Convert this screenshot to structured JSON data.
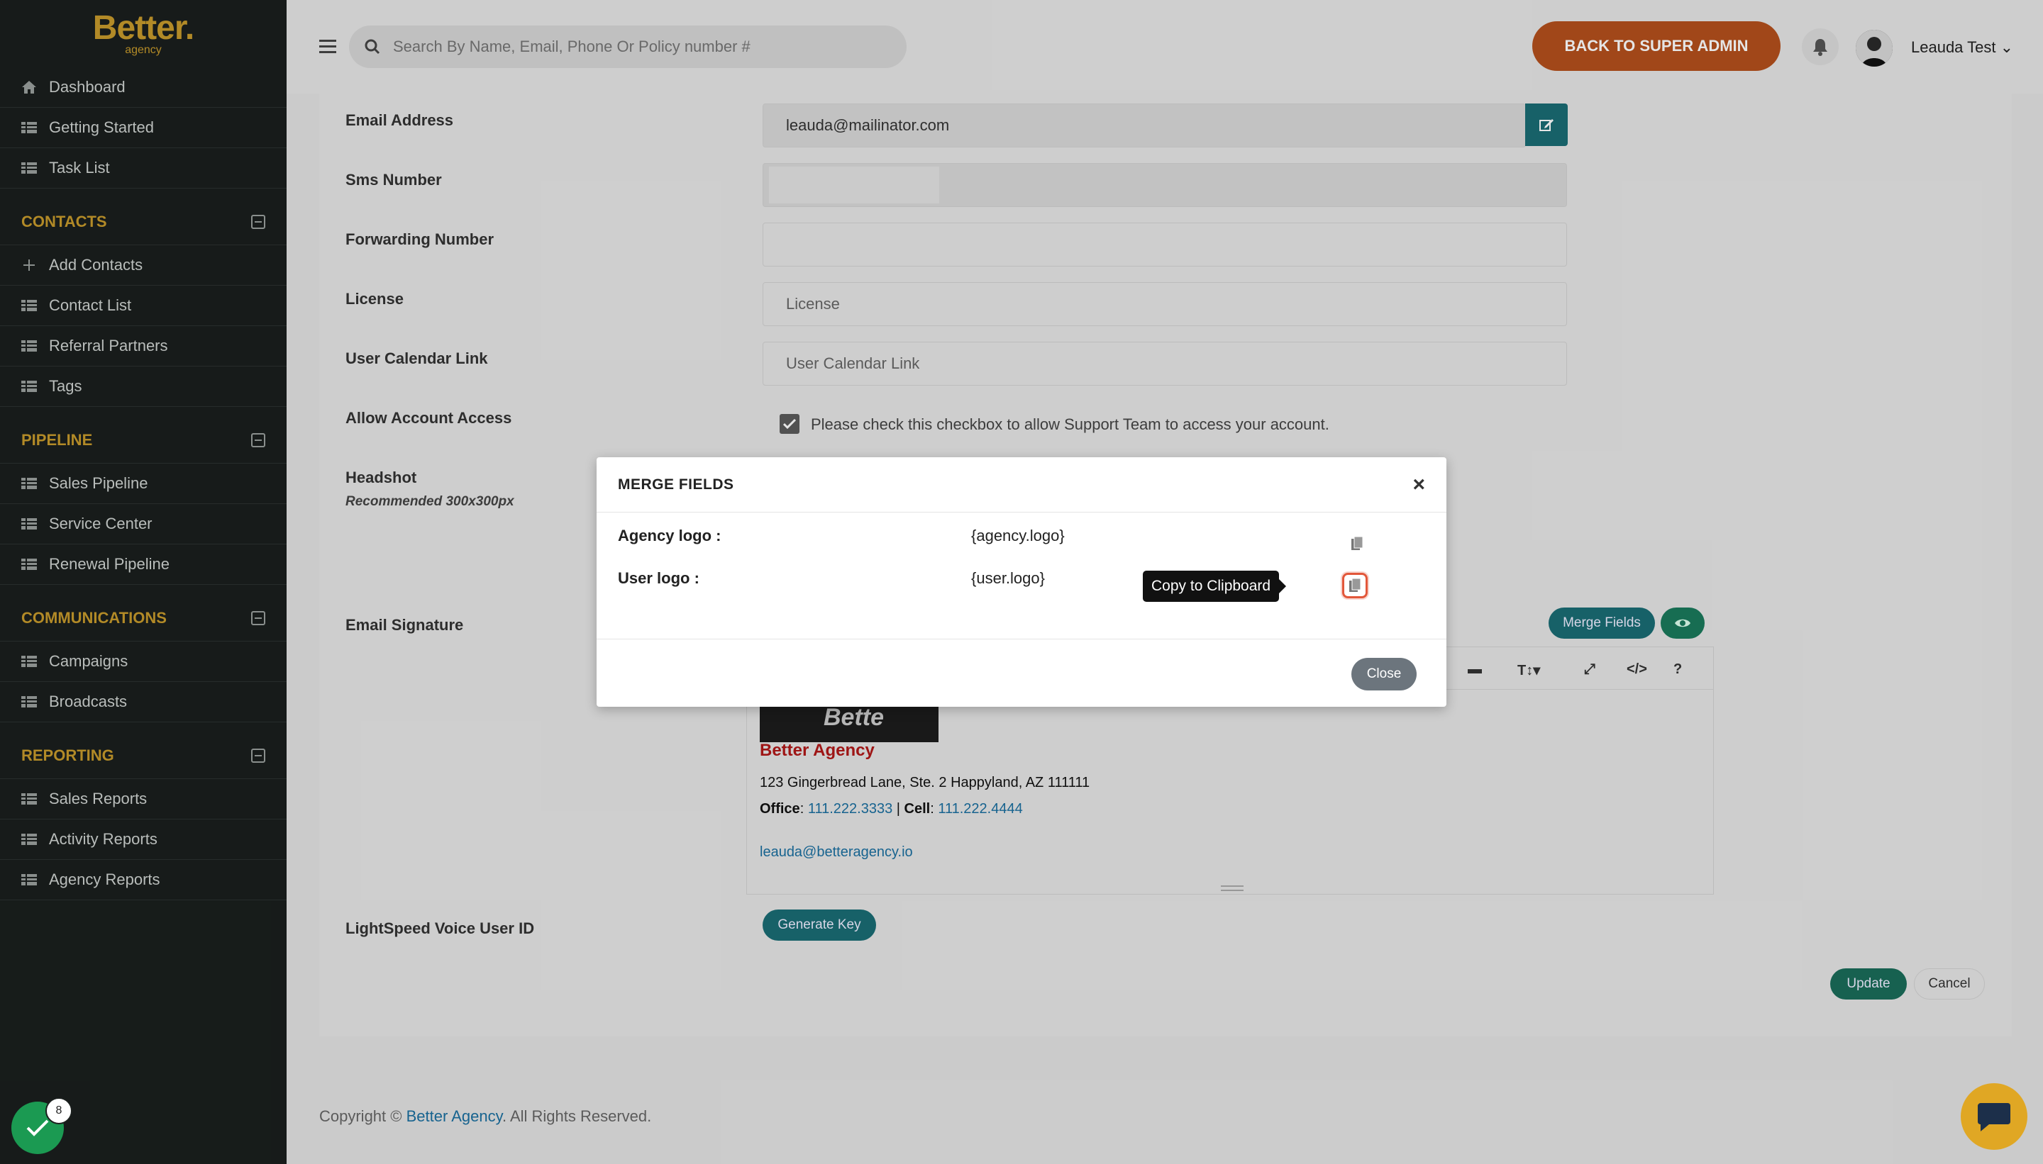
{
  "brand": {
    "name": "Better.",
    "sub": "agency"
  },
  "sidebar": {
    "top_items": [
      {
        "label": "Dashboard",
        "icon": "home-icon"
      },
      {
        "label": "Getting Started",
        "icon": "grid-icon"
      },
      {
        "label": "Task List",
        "icon": "grid-icon"
      }
    ],
    "sections": [
      {
        "title": "CONTACTS",
        "items": [
          {
            "label": "Add Contacts",
            "icon": "plus-icon"
          },
          {
            "label": "Contact List",
            "icon": "grid-icon"
          },
          {
            "label": "Referral Partners",
            "icon": "grid-icon"
          },
          {
            "label": "Tags",
            "icon": "grid-icon"
          }
        ]
      },
      {
        "title": "PIPELINE",
        "items": [
          {
            "label": "Sales Pipeline",
            "icon": "grid-icon"
          },
          {
            "label": "Service Center",
            "icon": "grid-icon"
          },
          {
            "label": "Renewal Pipeline",
            "icon": "grid-icon"
          }
        ]
      },
      {
        "title": "COMMUNICATIONS",
        "items": [
          {
            "label": "Campaigns",
            "icon": "grid-icon"
          },
          {
            "label": "Broadcasts",
            "icon": "grid-icon"
          }
        ]
      },
      {
        "title": "REPORTING",
        "items": [
          {
            "label": "Sales Reports",
            "icon": "grid-icon"
          },
          {
            "label": "Activity Reports",
            "icon": "grid-icon"
          },
          {
            "label": "Agency Reports",
            "icon": "grid-icon"
          }
        ]
      }
    ]
  },
  "topbar": {
    "search_placeholder": "Search By Name, Email, Phone Or Policy number #",
    "back_button": "BACK TO SUPER ADMIN",
    "user_name": "Leauda Test"
  },
  "form": {
    "email_label": "Email Address",
    "email_value": "leauda@mailinator.com",
    "sms_label": "Sms Number",
    "forwarding_label": "Forwarding Number",
    "license_label": "License",
    "license_placeholder": "License",
    "calendar_label": "User Calendar Link",
    "calendar_placeholder": "User Calendar Link",
    "access_label": "Allow Account Access",
    "access_text": "Please check this checkbox to allow Support Team to access your account.",
    "headshot_label": "Headshot",
    "headshot_sub": "Recommended 300x300px",
    "signature_label": "Email Signature",
    "merge_fields_button": "Merge Fields",
    "lightspeed_label": "LightSpeed Voice User ID",
    "generate_key_button": "Generate Key",
    "update_button": "Update",
    "cancel_button": "Cancel"
  },
  "signature": {
    "photo_text": "Bette",
    "agency": "Better Agency",
    "address": "123 Gingerbread Lane, Ste. 2 Happyland, AZ 111111",
    "office_label": "Office",
    "office_phone": "111.222.3333",
    "cell_label": "Cell",
    "cell_phone": "111.222.4444",
    "email": "leauda@betteragency.io"
  },
  "footer": {
    "prefix": "Copyright © ",
    "link": "Better Agency",
    "suffix": ". All Rights Reserved."
  },
  "modal": {
    "title": "MERGE FIELDS",
    "rows": [
      {
        "label": "Agency logo :",
        "value": "{agency.logo}"
      },
      {
        "label": "User logo :",
        "value": "{user.logo}"
      }
    ],
    "tooltip": "Copy to Clipboard",
    "close_button": "Close"
  },
  "widgets": {
    "badge_count": "8"
  },
  "colors": {
    "accent_gold": "#c79a2c",
    "teal": "#1a6c74",
    "orange": "#b4501c",
    "sidebar_bg": "#1a1f1d"
  }
}
